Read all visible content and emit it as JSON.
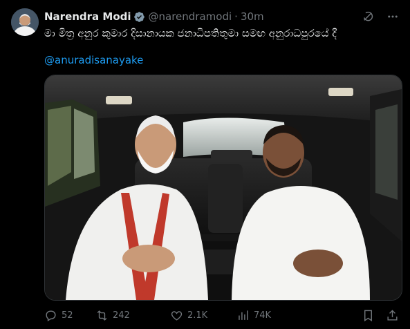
{
  "author": {
    "name": "Narendra Modi",
    "handle": "@narendramodi",
    "separator": "·",
    "time": "30m"
  },
  "tweet": {
    "text": "මා මිත්‍ර අනුර කුමාර දිසානායක ජනාධිපතිතුමා සමඟ අනුරාධපුරයේ දී",
    "mention": "@anuradisanayake"
  },
  "actions": {
    "replies": "52",
    "reposts": "242",
    "likes": "2.1K",
    "views": "74K"
  },
  "icons": {
    "verified": "verified-badge-icon",
    "grok": "grok-icon",
    "more": "more-icon",
    "reply": "reply-icon",
    "repost": "repost-icon",
    "like": "like-icon",
    "views": "views-icon",
    "bookmark": "bookmark-icon",
    "share": "share-icon"
  },
  "colors": {
    "background": "#000000",
    "text": "#e7e9ea",
    "secondary": "#71767b",
    "link": "#1d9bf0",
    "verified": "#829aab"
  }
}
